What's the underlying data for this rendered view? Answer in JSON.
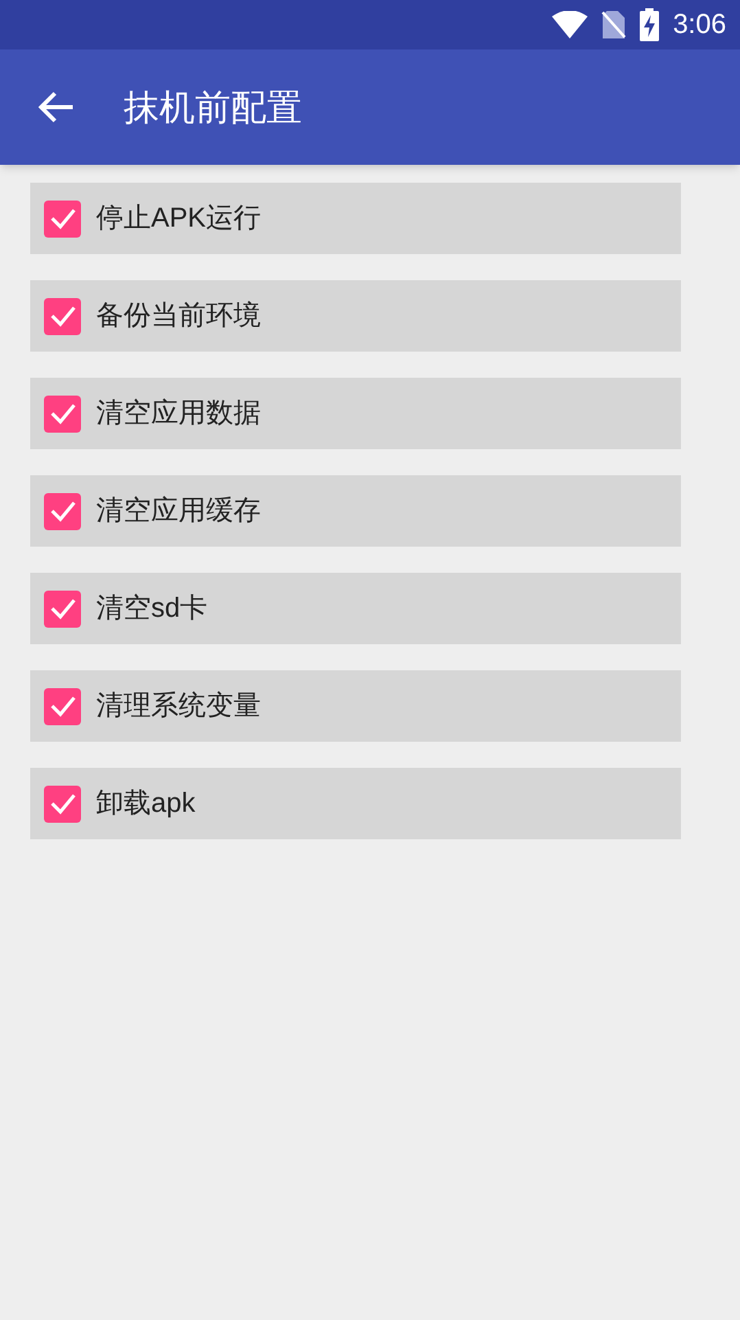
{
  "status_bar": {
    "time": "3:06"
  },
  "app_bar": {
    "title": "抹机前配置"
  },
  "options": [
    {
      "label": "停止APK运行",
      "checked": true
    },
    {
      "label": "备份当前环境",
      "checked": true
    },
    {
      "label": "清空应用数据",
      "checked": true
    },
    {
      "label": "清空应用缓存",
      "checked": true
    },
    {
      "label": "清空sd卡",
      "checked": true
    },
    {
      "label": "清理系统变量",
      "checked": true
    },
    {
      "label": "卸载apk",
      "checked": true
    }
  ]
}
